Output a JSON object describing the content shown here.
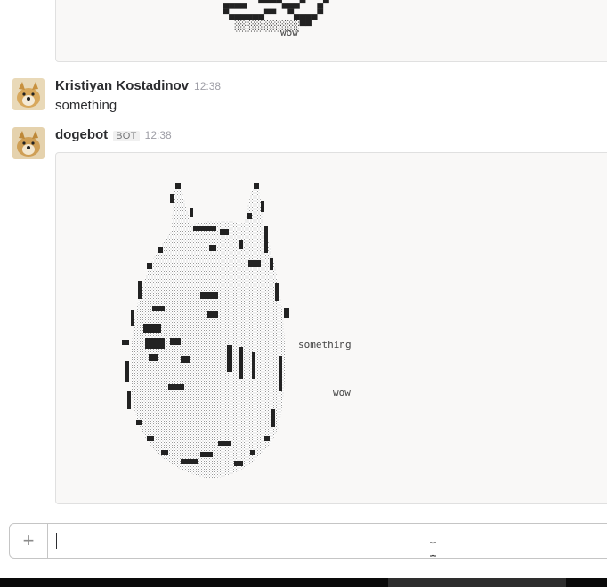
{
  "messages": [
    {
      "ascii_side_text": [
        "wow"
      ]
    },
    {
      "author": "Kristiyan Kostadinov",
      "time": "12:38",
      "text": "something",
      "avatar_icon": "doge-avatar"
    },
    {
      "author": "dogebot",
      "badge": "BOT",
      "time": "12:38",
      "avatar_icon": "doge-avatar",
      "ascii_side_text": [
        "something",
        "wow"
      ]
    }
  ],
  "composer": {
    "plus_icon": "plus-icon",
    "placeholder": "",
    "value": ""
  },
  "colors": {
    "ascii_background": "#f9f8f7",
    "timestamp": "#9e9ea6",
    "author": "#2c2d30"
  }
}
